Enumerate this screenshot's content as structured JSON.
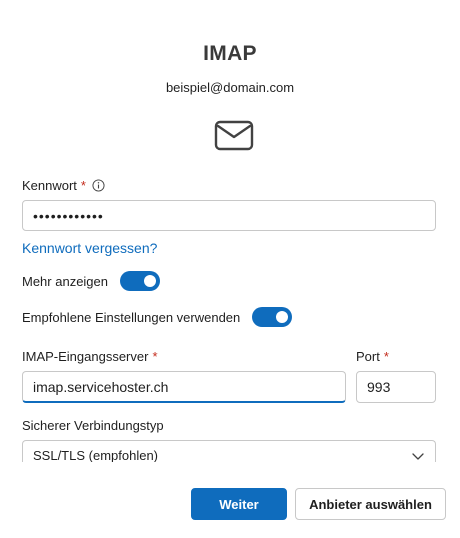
{
  "header": {
    "title": "IMAP",
    "email": "beispiel@domain.com"
  },
  "password": {
    "label": "Kennwort",
    "required_mark": "*",
    "value_masked": "••••••••••••"
  },
  "forgot_password": "Kennwort vergessen?",
  "toggles": {
    "show_more": {
      "label": "Mehr anzeigen",
      "on": true
    },
    "recommended": {
      "label": "Empfohlene Einstellungen verwenden",
      "on": true
    }
  },
  "server": {
    "label": "IMAP-Eingangsserver",
    "required_mark": "*",
    "value": "imap.servicehoster.ch"
  },
  "port": {
    "label": "Port",
    "required_mark": "*",
    "value": "993"
  },
  "security": {
    "label": "Sicherer Verbindungstyp",
    "selected": "SSL/TLS (empfohlen)"
  },
  "buttons": {
    "next": "Weiter",
    "choose_provider": "Anbieter auswählen"
  },
  "colors": {
    "accent": "#0f6cbd",
    "required": "#c42b1c"
  },
  "icons": {
    "mail": "envelope-icon",
    "info": "info-icon",
    "dropdown": "chevron-down-icon"
  }
}
